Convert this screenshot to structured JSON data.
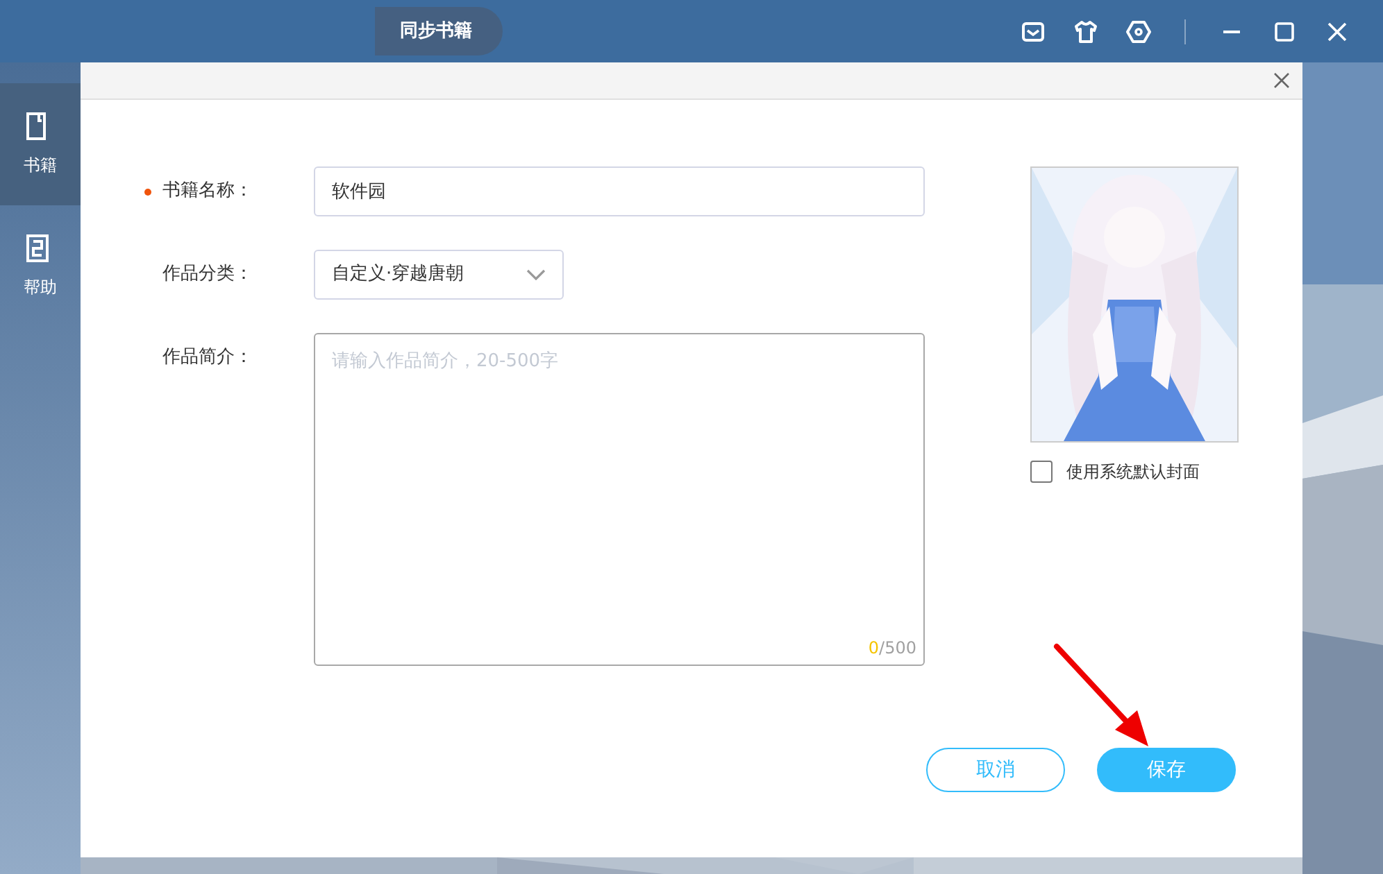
{
  "header": {
    "tab": "同步书籍"
  },
  "sidebar": {
    "items": [
      {
        "label": "书籍",
        "kind": "book",
        "selected": true
      },
      {
        "label": "帮助",
        "kind": "help",
        "selected": false
      }
    ]
  },
  "dialog": {
    "fields": [
      {
        "kind": "text",
        "label": "书籍名称：",
        "required": true,
        "value": "软件园"
      },
      {
        "kind": "select",
        "label": "作品分类：",
        "required": false,
        "value": "自定义·穿越唐朝"
      },
      {
        "kind": "textarea",
        "label": "作品简介：",
        "required": false,
        "placeholder": "请输入作品简介，20-500字",
        "count": "0",
        "limit": "/500"
      }
    ],
    "cover": {
      "kind": "picture",
      "default_cover": {
        "label": "使用系统默认封面",
        "checked": false
      }
    },
    "buttons": [
      {
        "label": "取消",
        "kind": "secondary"
      },
      {
        "label": "保存",
        "kind": "primary"
      }
    ]
  }
}
